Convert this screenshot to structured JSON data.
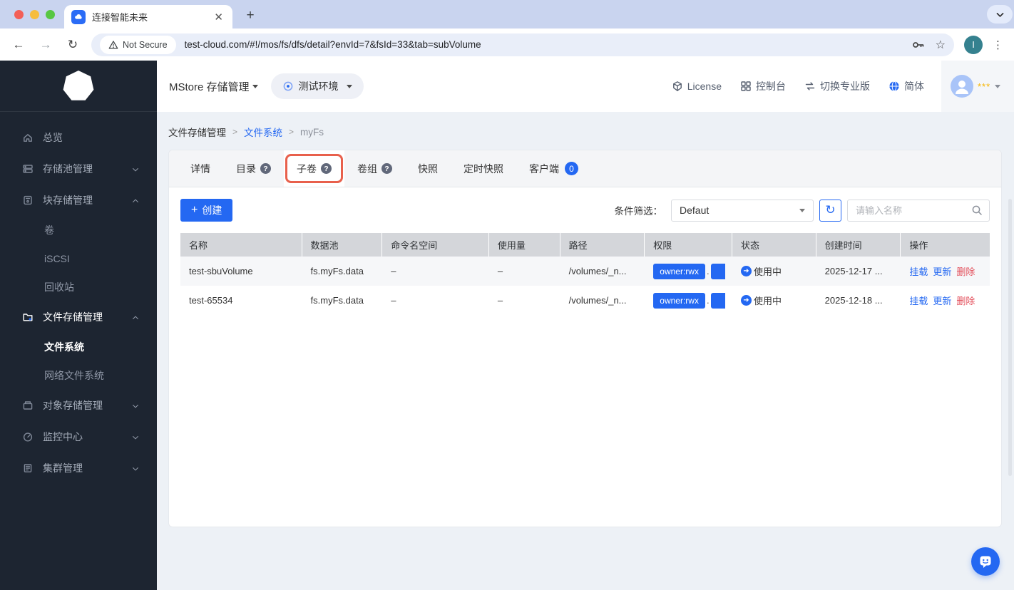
{
  "browser": {
    "tab_title": "连接智能未来",
    "security_label": "Not Secure",
    "url": "test-cloud.com/#!/mos/fs/dfs/detail?envId=7&fsId=33&tab=subVolume",
    "profile_initial": "I"
  },
  "app_header": {
    "brand": "MStore 存储管理",
    "environment": "测试环境",
    "nav": [
      {
        "label": "License",
        "icon": "license-icon"
      },
      {
        "label": "控制台",
        "icon": "console-icon"
      },
      {
        "label": "切换专业版",
        "icon": "switch-icon"
      },
      {
        "label": "简体",
        "icon": "globe-icon"
      }
    ],
    "user_label": "***"
  },
  "sidebar": {
    "items": [
      {
        "label": "总览",
        "icon": "home",
        "chevron": null,
        "active": false,
        "children": []
      },
      {
        "label": "存储池管理",
        "icon": "pool",
        "chevron": "down",
        "active": false,
        "children": []
      },
      {
        "label": "块存储管理",
        "icon": "block",
        "chevron": "up",
        "active": false,
        "children": [
          {
            "label": "卷",
            "active": false
          },
          {
            "label": "iSCSI",
            "active": false
          },
          {
            "label": "回收站",
            "active": false
          }
        ]
      },
      {
        "label": "文件存储管理",
        "icon": "file",
        "chevron": "up",
        "active": true,
        "children": [
          {
            "label": "文件系统",
            "active": true
          },
          {
            "label": "网络文件系统",
            "active": false
          }
        ]
      },
      {
        "label": "对象存储管理",
        "icon": "object",
        "chevron": "down",
        "active": false,
        "children": []
      },
      {
        "label": "监控中心",
        "icon": "monitor",
        "chevron": "down",
        "active": false,
        "children": []
      },
      {
        "label": "集群管理",
        "icon": "cluster",
        "chevron": "down",
        "active": false,
        "children": []
      }
    ]
  },
  "breadcrumb": [
    {
      "label": "文件存储管理",
      "type": "plain"
    },
    {
      "label": "文件系统",
      "type": "link"
    },
    {
      "label": "myFs",
      "type": "current"
    }
  ],
  "tabs": [
    {
      "label": "详情",
      "help": false,
      "selected": false,
      "highlighted": false,
      "badge": null
    },
    {
      "label": "目录",
      "help": true,
      "selected": false,
      "highlighted": false,
      "badge": null
    },
    {
      "label": "子卷",
      "help": true,
      "selected": true,
      "highlighted": true,
      "badge": null
    },
    {
      "label": "卷组",
      "help": true,
      "selected": false,
      "highlighted": false,
      "badge": null
    },
    {
      "label": "快照",
      "help": false,
      "selected": false,
      "highlighted": false,
      "badge": null
    },
    {
      "label": "定时快照",
      "help": false,
      "selected": false,
      "highlighted": false,
      "badge": null
    },
    {
      "label": "客户端",
      "help": false,
      "selected": false,
      "highlighted": false,
      "badge": "0"
    }
  ],
  "toolbar": {
    "create_label": "创建",
    "filter_label": "条件筛选：",
    "filter_value": "Defaut",
    "search_placeholder": "请输入名称"
  },
  "table": {
    "headers": [
      "名称",
      "数据池",
      "命令名空间",
      "使用量",
      "路径",
      "权限",
      "状态",
      "创建时间",
      "操作"
    ],
    "rows": [
      {
        "name": "test-sbuVolume",
        "pool": "fs.myFs.data",
        "namespace": "–",
        "usage": "–",
        "path": "/volumes/_n...",
        "permission": "owner:rwx",
        "permission_more": ".",
        "status": "使用中",
        "created": "2025-12-17 ...",
        "actions": [
          {
            "label": "挂载",
            "danger": false
          },
          {
            "label": "更新",
            "danger": false
          },
          {
            "label": "删除",
            "danger": true
          }
        ]
      },
      {
        "name": "test-65534",
        "pool": "fs.myFs.data",
        "namespace": "–",
        "usage": "–",
        "path": "/volumes/_n...",
        "permission": "owner:rwx",
        "permission_more": ".",
        "status": "使用中",
        "created": "2025-12-18 ...",
        "actions": [
          {
            "label": "挂载",
            "danger": false
          },
          {
            "label": "更新",
            "danger": false
          },
          {
            "label": "删除",
            "danger": true
          }
        ]
      }
    ]
  },
  "colors": {
    "accent_blue": "#2468f2",
    "danger_red": "#e34d59",
    "highlight_box": "#e8604c",
    "sidebar_bg": "#1d2531",
    "table_header_bg": "#d4d6da",
    "star_orange": "#f7b500"
  }
}
